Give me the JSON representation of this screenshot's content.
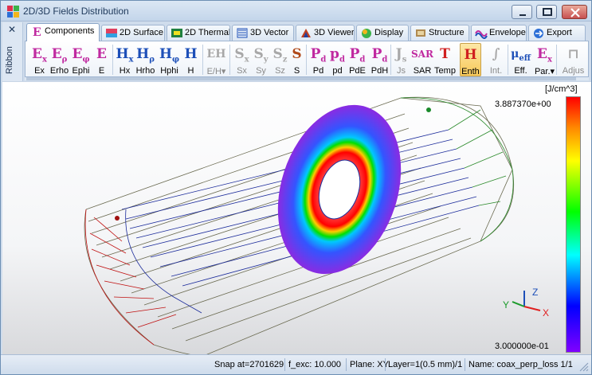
{
  "window": {
    "title": "2D/3D Fields Distribution",
    "icon": "multicolor-grid-icon"
  },
  "ribbon": {
    "close_glyph": "✕",
    "side_label": "Ribbon"
  },
  "tabs": [
    {
      "label": "Components",
      "icon": "e-field-icon",
      "active": true
    },
    {
      "label": "2D Surface",
      "icon": "surface-icon",
      "active": false
    },
    {
      "label": "2D Thermal",
      "icon": "thermal-icon",
      "active": false
    },
    {
      "label": "3D Vector",
      "icon": "vector-icon",
      "active": false
    },
    {
      "label": "3D Viewer",
      "icon": "viewer-icon",
      "active": false
    },
    {
      "label": "Display",
      "icon": "display-icon",
      "active": false
    },
    {
      "label": "Structure",
      "icon": "structure-icon",
      "active": false
    },
    {
      "label": "Envelope",
      "icon": "envelope-icon",
      "active": false
    },
    {
      "label": "Export",
      "icon": "export-icon",
      "active": false
    }
  ],
  "toolbar": {
    "tools": [
      {
        "label": "Ex",
        "glyph": "E",
        "sub": "x",
        "color": "#c02aa0"
      },
      {
        "label": "Erho",
        "glyph": "E",
        "sub": "ρ",
        "color": "#c02aa0"
      },
      {
        "label": "Ephi",
        "glyph": "E",
        "sub": "φ",
        "color": "#c02aa0"
      },
      {
        "label": "E",
        "glyph": "E",
        "sub": "",
        "color": "#c02aa0"
      },
      {
        "label": "Hx",
        "glyph": "H",
        "sub": "x",
        "color": "#1d4fb8"
      },
      {
        "label": "Hrho",
        "glyph": "H",
        "sub": "ρ",
        "color": "#1d4fb8"
      },
      {
        "label": "Hphi",
        "glyph": "H",
        "sub": "φ",
        "color": "#1d4fb8"
      },
      {
        "label": "H",
        "glyph": "H",
        "sub": "",
        "color": "#1d4fb8"
      },
      {
        "label": "E/H",
        "glyph": "EH",
        "sub": "",
        "color": "#9a9a9a",
        "disabled": true
      },
      {
        "label": "Sx",
        "glyph": "S",
        "sub": "x",
        "color": "#9a9a9a",
        "disabled": true
      },
      {
        "label": "Sy",
        "glyph": "S",
        "sub": "y",
        "color": "#9a9a9a",
        "disabled": true
      },
      {
        "label": "Sz",
        "glyph": "S",
        "sub": "z",
        "color": "#9a9a9a",
        "disabled": true
      },
      {
        "label": "S",
        "glyph": "S",
        "sub": "",
        "color": "#b04a1a"
      },
      {
        "label": "Pd",
        "glyph": "P",
        "sub": "d",
        "color": "#c02aa0"
      },
      {
        "label": "pd",
        "glyph": "p",
        "sub": "d",
        "color": "#c02aa0"
      },
      {
        "label": "PdE",
        "glyph": "P",
        "sub": "d",
        "color": "#c02aa0"
      },
      {
        "label": "PdH",
        "glyph": "P",
        "sub": "d",
        "color": "#c02aa0"
      },
      {
        "label": "Js",
        "glyph": "J",
        "sub": "s",
        "color": "#9a9a9a",
        "disabled": true
      },
      {
        "label": "SAR",
        "glyph": "SAR",
        "sub": "",
        "color": "#c02aa0"
      },
      {
        "label": "Temp",
        "glyph": "T",
        "sub": "",
        "color": "#d02020"
      },
      {
        "label": "Enth",
        "glyph": "H",
        "sub": "",
        "color": "#d02020",
        "selected": true
      },
      {
        "label": "Int.",
        "glyph": "∫",
        "sub": "",
        "color": "#9a9a9a",
        "disabled": true
      },
      {
        "label": "Eff.",
        "glyph": "μ",
        "sub": "eff",
        "color": "#1d4fb8"
      },
      {
        "label": "Par.",
        "glyph": "E",
        "sub": "x",
        "color": "#c02aa0"
      },
      {
        "label": "Adjus",
        "glyph": "⊓",
        "sub": "",
        "color": "#9a9a9a",
        "disabled": true
      }
    ]
  },
  "viewport": {
    "unit": "[J/cm^3]",
    "max_value": "3.887370e+00",
    "min_value": "3.000000e-01",
    "axes": {
      "x": "X",
      "y": "Y",
      "z": "Z"
    }
  },
  "status": {
    "snap": "Snap at=2701629",
    "freq": "f_exc: 10.000",
    "plane": "Plane: XY",
    "layer": "Layer=1(0.5 mm)/1",
    "name": "Name: coax_perp_loss 1/1"
  }
}
